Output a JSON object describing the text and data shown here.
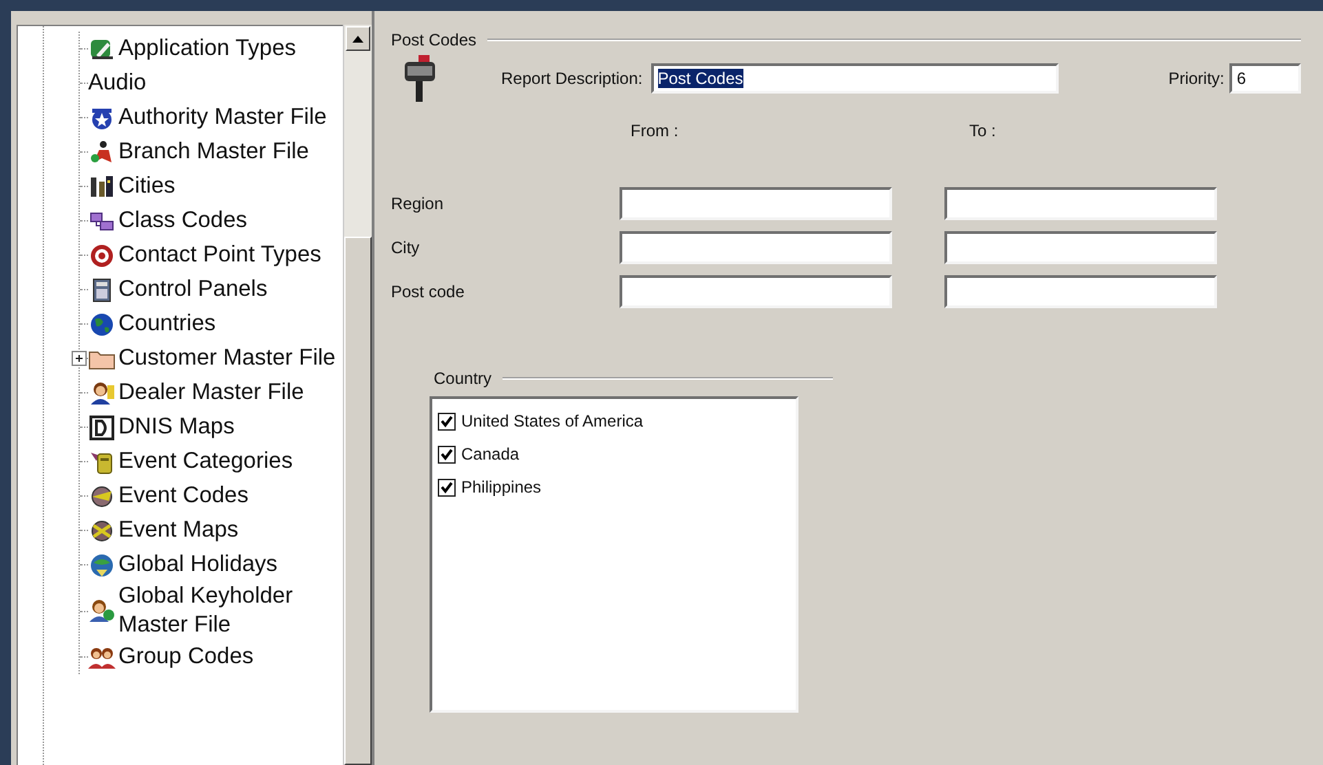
{
  "tree": {
    "items": [
      {
        "label": "Application Types",
        "kind": "leaf"
      },
      {
        "label": "Audio",
        "kind": "plain"
      },
      {
        "label": "Authority Master File",
        "kind": "leaf"
      },
      {
        "label": "Branch Master File",
        "kind": "leaf"
      },
      {
        "label": "Cities",
        "kind": "leaf"
      },
      {
        "label": "Class Codes",
        "kind": "leaf"
      },
      {
        "label": "Contact Point Types",
        "kind": "leaf"
      },
      {
        "label": "Control Panels",
        "kind": "leaf"
      },
      {
        "label": "Countries",
        "kind": "leaf"
      },
      {
        "label": "Customer Master File",
        "kind": "folder",
        "expanded": false
      },
      {
        "label": "Dealer Master File",
        "kind": "leaf"
      },
      {
        "label": "DNIS Maps",
        "kind": "leaf"
      },
      {
        "label": "Event Categories",
        "kind": "leaf"
      },
      {
        "label": "Event Codes",
        "kind": "leaf"
      },
      {
        "label": "Event Maps",
        "kind": "leaf"
      },
      {
        "label": "Global Holidays",
        "kind": "leaf"
      },
      {
        "label": "Global Keyholder Master File",
        "kind": "leaf"
      },
      {
        "label": "Group Codes",
        "kind": "leaf"
      }
    ]
  },
  "form": {
    "group_title": "Post Codes",
    "description": {
      "label": "Report Description:",
      "value": "Post Codes",
      "value_selected": true
    },
    "priority": {
      "label": "Priority:",
      "value": "6"
    },
    "from_header": "From :",
    "to_header": "To :",
    "ranges": [
      {
        "label": "Region"
      },
      {
        "label": "City"
      },
      {
        "label": "Post code"
      }
    ],
    "country": {
      "title": "Country",
      "items": [
        {
          "label": "United States of America",
          "checked": true
        },
        {
          "label": "Canada",
          "checked": true
        },
        {
          "label": "Philippines",
          "checked": true
        }
      ]
    }
  }
}
